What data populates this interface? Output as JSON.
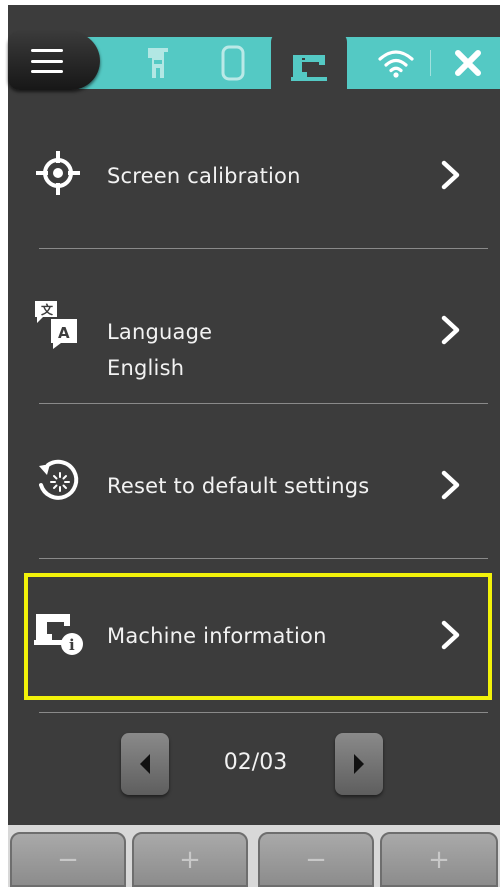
{
  "tabs": {
    "menu": {
      "icon": "hamburger-menu-icon"
    },
    "items": [
      {
        "icon": "presser-foot-icon"
      },
      {
        "icon": "embroidery-hoop-icon"
      },
      {
        "icon": "sewing-machine-icon",
        "active": true
      },
      {
        "icon": "wifi-icon"
      },
      {
        "icon": "close-icon"
      }
    ]
  },
  "settings": {
    "items": [
      {
        "label": "Screen calibration",
        "icon": "crosshair-target-icon"
      },
      {
        "label": "Language",
        "value": "English",
        "icon": "translate-icon"
      },
      {
        "label": "Reset to default settings",
        "icon": "reset-icon"
      },
      {
        "label": "Machine information",
        "icon": "machine-info-icon",
        "highlighted": true
      }
    ]
  },
  "pagination": {
    "text": "02/03"
  },
  "hardware_keys": {
    "left_minus": "−",
    "left_plus": "+",
    "right_minus": "−",
    "right_plus": "+"
  },
  "colors": {
    "background": "#3c3c3c",
    "tab_accent": "#54c9c4",
    "highlight": "#f2f20a"
  }
}
